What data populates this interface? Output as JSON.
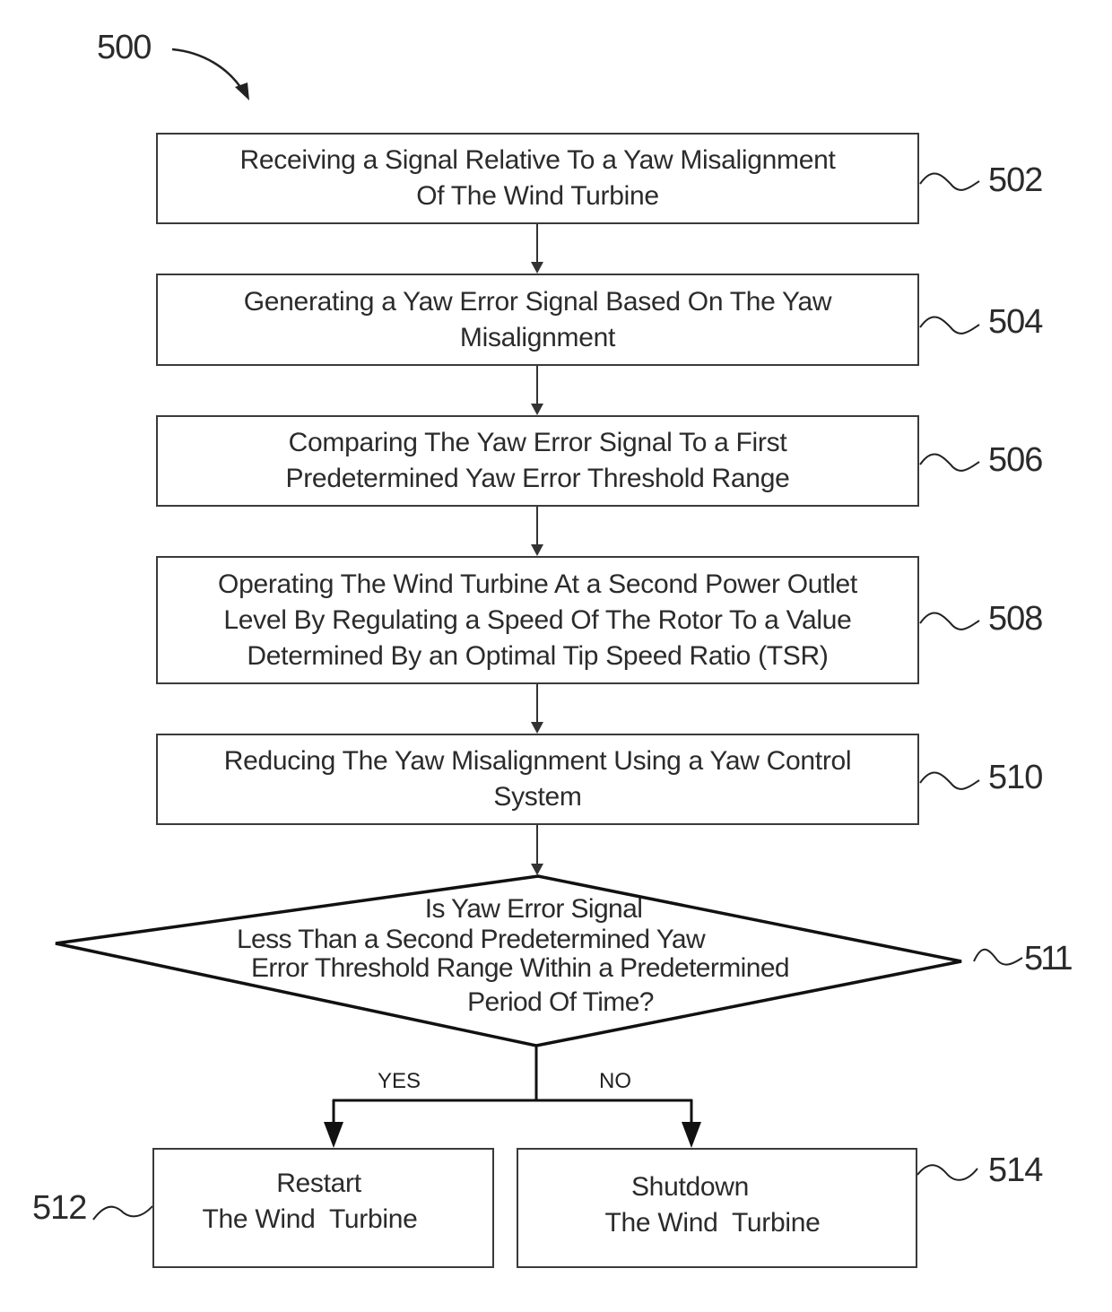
{
  "figure": {
    "number": "500"
  },
  "steps": [
    {
      "ref": "502",
      "text": "Receiving a Signal Relative To a Yaw Misalignment\nOf The Wind Turbine"
    },
    {
      "ref": "504",
      "text": "Generating a Yaw Error Signal Based On The Yaw\nMisalignment"
    },
    {
      "ref": "506",
      "text": "Comparing The Yaw Error Signal To a First\nPredetermined Yaw Error Threshold Range"
    },
    {
      "ref": "508",
      "text": "Operating The Wind Turbine At a Second Power Outlet\nLevel By Regulating a Speed Of The Rotor To a Value\nDetermined By an Optimal Tip Speed Ratio (TSR)"
    },
    {
      "ref": "510",
      "text": "Reducing The Yaw Misalignment Using a Yaw Control\nSystem"
    }
  ],
  "decision": {
    "ref": "511",
    "lines": [
      "Is Yaw Error Signal",
      "Less Than a Second Predetermined Yaw",
      "Error Threshold Range Within a Predetermined",
      "Period Of Time?"
    ],
    "yes_label": "YES",
    "no_label": "NO"
  },
  "outcomes": {
    "yes": {
      "ref": "512",
      "line1": "Restart",
      "line2": "The Wind  Turbine"
    },
    "no": {
      "ref": "514",
      "line1": "Shutdown",
      "line2": "The Wind  Turbine"
    }
  }
}
